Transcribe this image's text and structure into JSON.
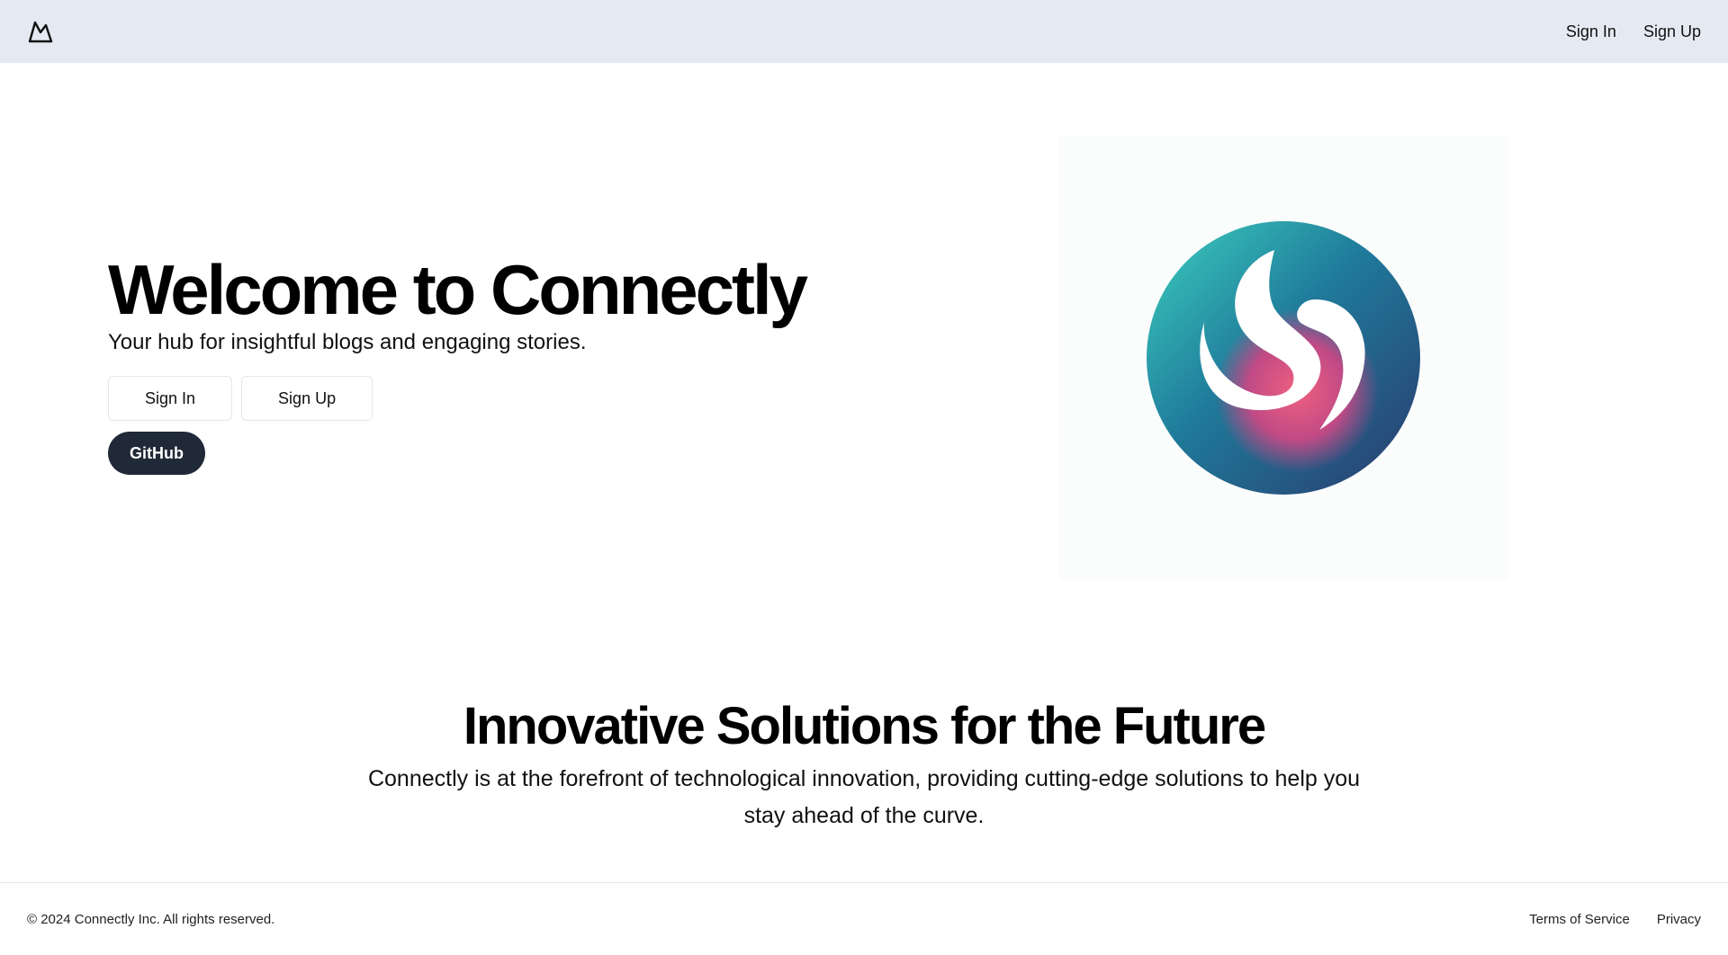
{
  "header": {
    "logo_icon": "mountain-icon",
    "nav": {
      "sign_in": "Sign In",
      "sign_up": "Sign Up"
    }
  },
  "hero": {
    "title": "Welcome to Connectly",
    "subtitle": "Your hub for insightful blogs and engaging stories.",
    "buttons": {
      "sign_in": "Sign In",
      "sign_up": "Sign Up",
      "github": "GitHub"
    },
    "image_icon": "connectly-swirl-logo"
  },
  "feature": {
    "title": "Innovative Solutions for the Future",
    "description": "Connectly is at the forefront of technological innovation, providing cutting-edge solutions to help you stay ahead of the curve."
  },
  "footer": {
    "copyright": "© 2024 Connectly Inc. All rights reserved.",
    "links": {
      "terms": "Terms of Service",
      "privacy": "Privacy"
    }
  },
  "colors": {
    "topbar_bg": "#e5eaf2",
    "dark_button": "#1f2937",
    "logo_teal": "#3ccfbf",
    "logo_blue": "#1f5c85",
    "logo_pink": "#e8547a"
  }
}
